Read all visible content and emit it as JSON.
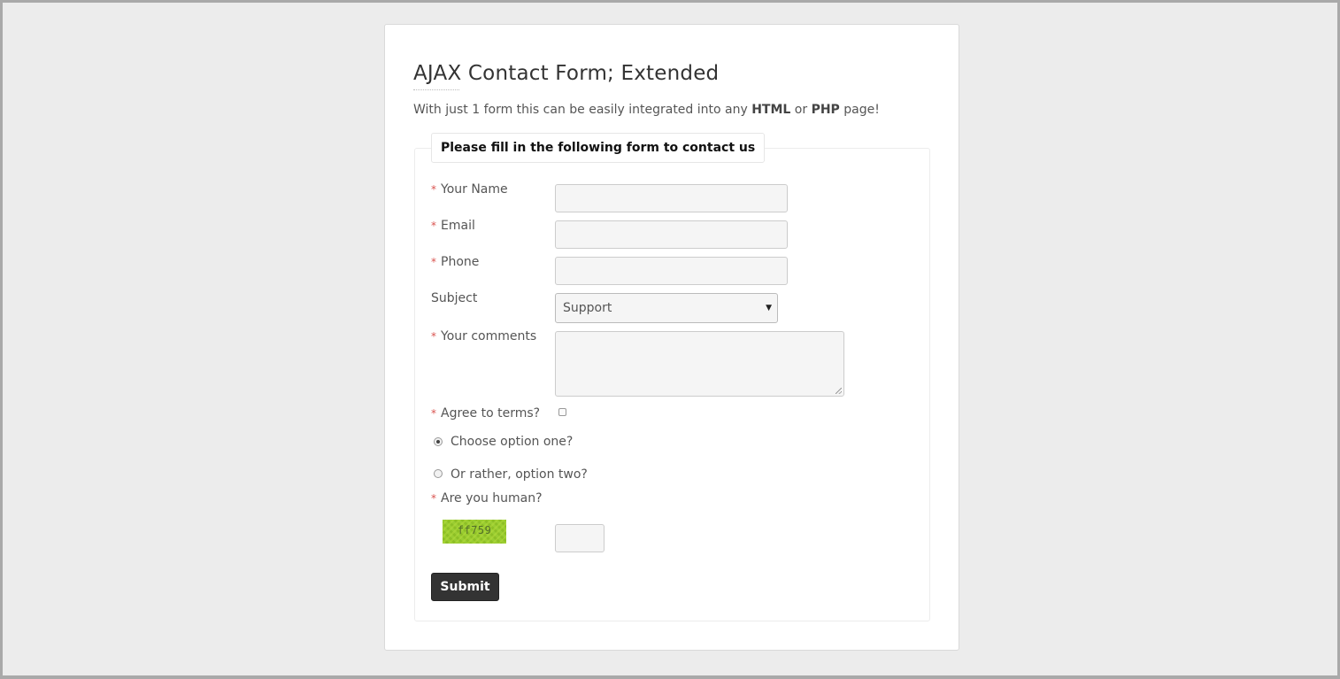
{
  "page": {
    "title": "AJAX Contact Form; Extended",
    "intro": {
      "prefix": "With just 1 form this can be easily integrated into any ",
      "html": "HTML",
      "middle": " or ",
      "php": "PHP",
      "suffix": " page!"
    }
  },
  "form": {
    "legend": "Please fill in the following form to contact us",
    "required_marker": "*",
    "fields": {
      "name_label": "Your Name",
      "email_label": "Email",
      "phone_label": "Phone",
      "subject_label": "Subject",
      "subject_value": "Support",
      "comments_label": "Your comments",
      "terms_label": "Agree to terms?",
      "terms_checked": false,
      "option_one_label": "Choose option one?",
      "option_one_checked": true,
      "option_two_label": "Or rather, option two?",
      "option_two_checked": false,
      "human_label": "Are you human?",
      "captcha_text": "ff759"
    },
    "submit_label": "Submit"
  },
  "colors": {
    "required": "#d9534f",
    "submit_bg": "#333333",
    "captcha_bg": "#9acd32"
  }
}
